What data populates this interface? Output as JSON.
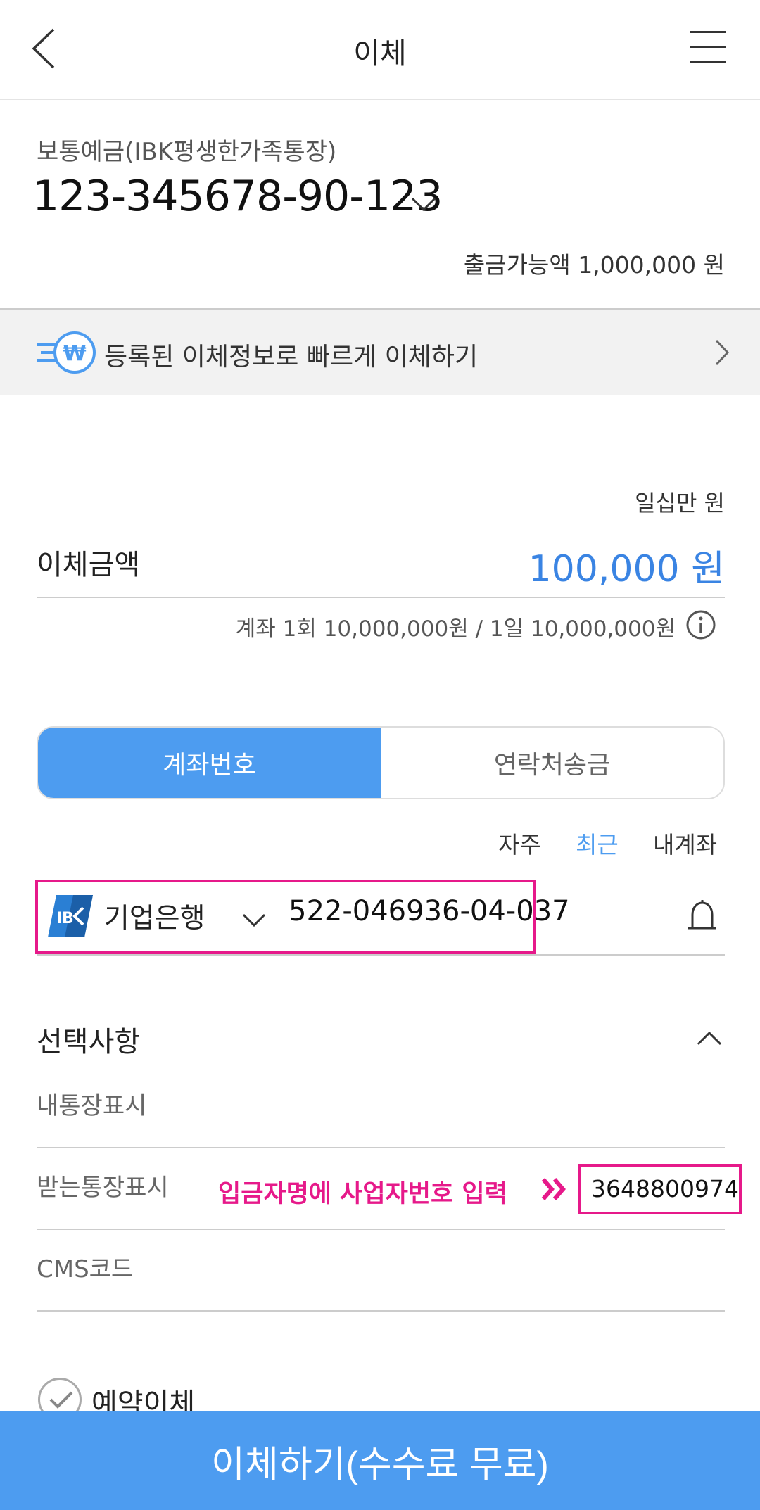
{
  "header": {
    "title": "이체"
  },
  "account": {
    "type": "보통예금(IBK평생한가족통장)",
    "number": "123-345678-90-123",
    "available": "출금가능액 1,000,000 원"
  },
  "quick_transfer": {
    "label": "등록된 이체정보로 빠르게 이체하기"
  },
  "amount": {
    "hangul": "일십만 원",
    "label": "이체금액",
    "value": "100,000 원",
    "limit": "계좌 1회 10,000,000원 / 1일 10,000,000원"
  },
  "tabs": [
    {
      "label": "계좌번호",
      "active": true
    },
    {
      "label": "연락처송금",
      "active": false
    }
  ],
  "filters": [
    "자주",
    "최근",
    "내계좌"
  ],
  "recipient": {
    "bank_name": "기업은행",
    "account_number": "522-046936-04-037"
  },
  "options": {
    "title": "선택사항",
    "my_passbook_label": "내통장표시",
    "recv_passbook_label": "받는통장표시",
    "recv_passbook_value": "3648800974",
    "cms_label": "CMS코드"
  },
  "annotation": {
    "text": "입금자명에 사업자번호 입력"
  },
  "reserve": {
    "label": "예약이체"
  },
  "cta": {
    "label": "이체하기(수수료 무료)"
  },
  "colors": {
    "accent": "#4d9cf0",
    "annotation": "#e6198a"
  }
}
